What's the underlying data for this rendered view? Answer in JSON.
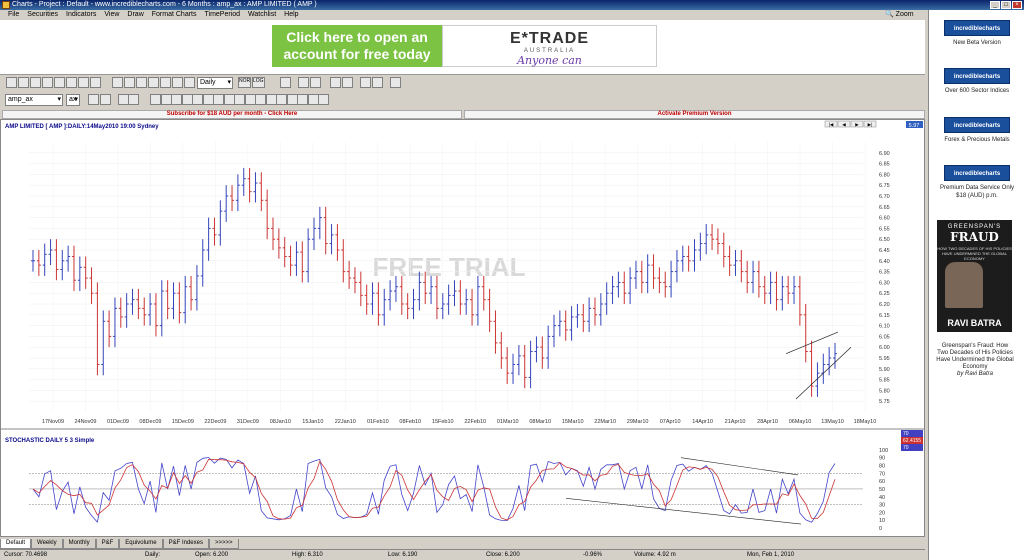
{
  "window": {
    "title": "Charts - Project : Default - www.incrediblecharts.com - 6 Months : amp_ax : AMP LIMITED  ( AMP )"
  },
  "menu": [
    "File",
    "Securities",
    "Indicators",
    "View",
    "Draw",
    "Format Charts",
    "TimePeriod",
    "Watchlist",
    "Help"
  ],
  "zoom_label": "Zoom",
  "ad": {
    "green_text": "Click here to open an account for free today",
    "brand": "E*TRADE",
    "brand_sub": "AUSTRALIA",
    "slogan": "Anyone can"
  },
  "toolbar": {
    "period": "Daily",
    "security": "amp_ax",
    "exchange": "ax",
    "nor": "NOR",
    "log": "LOG"
  },
  "banner": {
    "left": "Subscribe for $18 AUD per month - Click Here",
    "right": "Activate Premium Version"
  },
  "chart_data": [
    {
      "type": "ohlc",
      "title": "AMP LIMITED [ AMP ]:DAILY:14May2010 19:00 Sydney",
      "watermark": "FREE TRIAL",
      "last_value": "5.97",
      "ylim": [
        5.7,
        6.95
      ],
      "yticks": [
        "6.90",
        "6.85",
        "6.80",
        "6.75",
        "6.70",
        "6.65",
        "6.60",
        "6.55",
        "6.50",
        "6.45",
        "6.40",
        "6.35",
        "6.30",
        "6.25",
        "6.20",
        "6.15",
        "6.10",
        "6.05",
        "6.00",
        "5.95",
        "5.90",
        "5.85",
        "5.80",
        "5.75"
      ],
      "xticks": [
        "17Nov09",
        "24Nov09",
        "01Dec09",
        "08Dec09",
        "15Dec09",
        "22Dec09",
        "31Dec09",
        "08Jan10",
        "15Jan10",
        "22Jan10",
        "01Feb10",
        "08Feb10",
        "15Feb10",
        "22Feb10",
        "01Mar10",
        "08Mar10",
        "15Mar10",
        "22Mar10",
        "29Mar10",
        "07Apr10",
        "14Apr10",
        "21Apr10",
        "28Apr10",
        "06May10",
        "13May10",
        "18May10"
      ],
      "closes": [
        6.4,
        6.38,
        6.43,
        6.45,
        6.36,
        6.4,
        6.42,
        6.31,
        6.37,
        6.32,
        6.25,
        5.92,
        6.12,
        6.05,
        6.18,
        6.14,
        6.2,
        6.22,
        6.18,
        6.15,
        6.2,
        6.1,
        6.26,
        6.18,
        6.25,
        6.16,
        6.28,
        6.22,
        6.33,
        6.45,
        6.55,
        6.52,
        6.63,
        6.7,
        6.68,
        6.75,
        6.78,
        6.72,
        6.76,
        6.68,
        6.55,
        6.5,
        6.46,
        6.42,
        6.38,
        6.44,
        6.35,
        6.5,
        6.55,
        6.6,
        6.48,
        6.52,
        6.45,
        6.35,
        6.32,
        6.3,
        6.24,
        6.2,
        6.25,
        6.15,
        6.22,
        6.26,
        6.28,
        6.2,
        6.18,
        6.22,
        6.3,
        6.25,
        6.28,
        6.18,
        6.2,
        6.24,
        6.26,
        6.2,
        6.22,
        6.15,
        6.28,
        6.22,
        6.12,
        6.02,
        5.95,
        5.88,
        5.92,
        5.96,
        5.86,
        5.98,
        6.0,
        5.95,
        6.05,
        6.1,
        6.12,
        6.08,
        6.14,
        6.15,
        6.12,
        6.18,
        6.15,
        6.2,
        6.25,
        6.28,
        6.3,
        6.25,
        6.32,
        6.35,
        6.3,
        6.38,
        6.32,
        6.3,
        6.28,
        6.35,
        6.4,
        6.42,
        6.4,
        6.45,
        6.48,
        6.52,
        6.5,
        6.48,
        6.42,
        6.38,
        6.4,
        6.35,
        6.3,
        6.35,
        6.28,
        6.25,
        6.3,
        6.22,
        6.28,
        6.25,
        6.28,
        6.15,
        5.98,
        5.82,
        5.88,
        5.92,
        5.95,
        5.97
      ],
      "trendlines": "rising wedge near 06May10-13May10"
    },
    {
      "type": "line",
      "title": "STOCHASTIC DAILY 5 3 Simple",
      "ylim": [
        0,
        105
      ],
      "yticks": [
        "100",
        "90",
        "80",
        "70",
        "60",
        "50",
        "40",
        "30",
        "20",
        "10",
        "0"
      ],
      "reference_levels": [
        70,
        50,
        30
      ],
      "legend_values": [
        "70",
        "62.4155",
        "70"
      ],
      "series_colors": [
        "#4444cc",
        "#cc3333"
      ]
    }
  ],
  "tabs": [
    "Default",
    "Weekly",
    "Monthly",
    "P&F",
    "Equivolume",
    "P&F Indexes",
    ">>>>>"
  ],
  "status": {
    "cursor": "Cursor: 70.4698",
    "period": "Daily:",
    "open": "Open: 6.200",
    "high": "High: 6.310",
    "low": "Low: 6.190",
    "close": "Close: 6.200",
    "change": "-0.96%",
    "volume": "Volume: 4.92 m",
    "date": "Mon, Feb 1, 2010"
  },
  "sidebar": {
    "items": [
      {
        "btn": "incrediblecharts",
        "text": "New Beta Version"
      },
      {
        "btn": "incrediblecharts",
        "text": "Over 600 Sector Indices"
      },
      {
        "btn": "incrediblecharts",
        "text": "Forex & Precious Metals"
      },
      {
        "btn": "incrediblecharts",
        "text": "Premium Data Service Only $18 (AUD) p.m."
      }
    ],
    "book": {
      "top": "GREENSPAN'S",
      "title": "FRAUD",
      "sub": "HOW TWO DECADES OF HIS POLICIES HAVE UNDERMINED THE GLOBAL ECONOMY",
      "author": "RAVI BATRA",
      "caption": "Greenspan's Fraud: How Two Decades of His Policies Have Undermined the Global Economy",
      "caption_by": "by Ravi Batra"
    }
  }
}
